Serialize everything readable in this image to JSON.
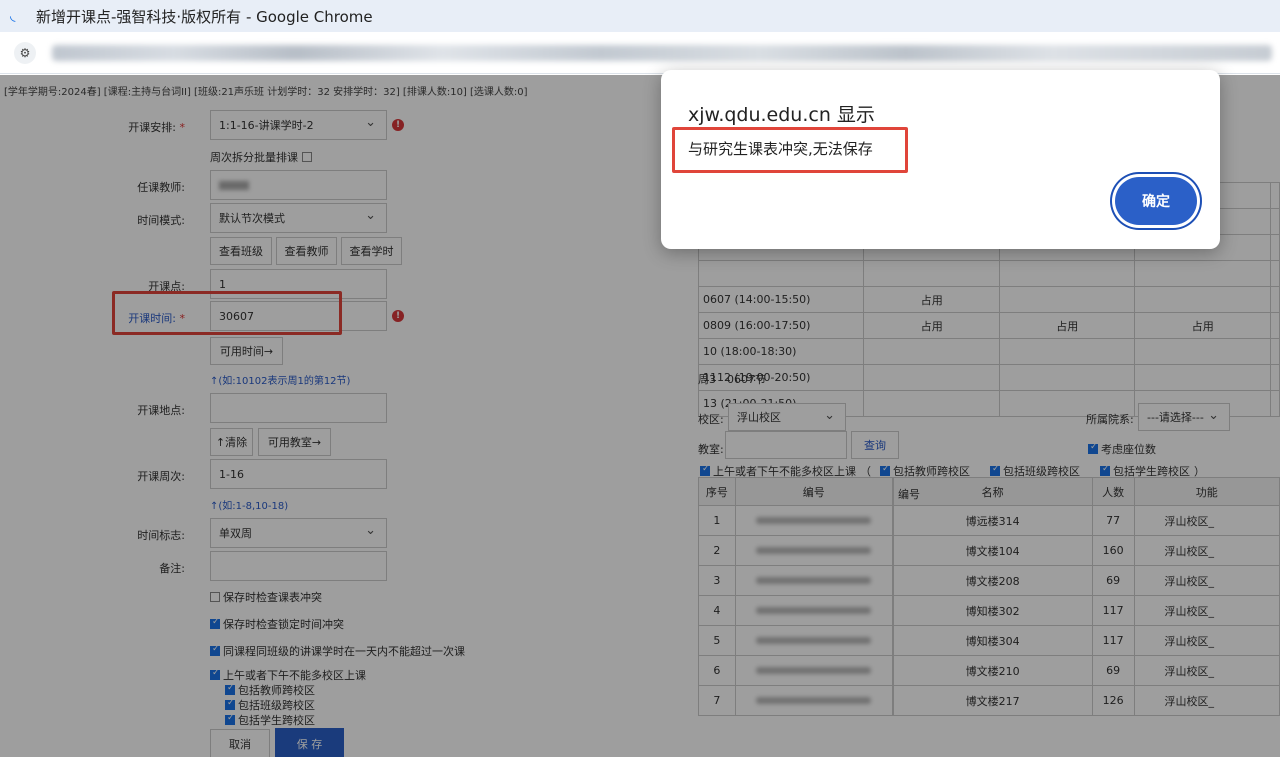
{
  "window": {
    "title": "新增开课点-强智科技·版权所有 - Google Chrome"
  },
  "info_line": "[学年学期号:2024春] [课程:主持与台词II] [班级:21声乐班 计划学时：32 安排学时：32] [排课人数:10] [选课人数:0]",
  "form": {
    "arrangement_label": "开课安排:",
    "arrangement_value": "1:1-16-讲课学时-2",
    "batch_label": "周次拆分批量排课",
    "teacher_label": "任课教师:",
    "teacher_value": "",
    "time_mode_label": "时间模式:",
    "time_mode_value": "默认节次模式",
    "view_class": "查看班级",
    "view_teacher": "查看教师",
    "view_hours": "查看学时",
    "point_label": "开课点:",
    "point_value": "1",
    "time_label": "开课时间:",
    "time_value": "30607",
    "available_time": "可用时间→",
    "time_hint": "↑(如:10102表示周1的第12节)",
    "location_label": "开课地点:",
    "location_value": "",
    "clear": "↑清除",
    "available_room": "可用教室→",
    "weeks_label": "开课周次:",
    "weeks_value": "1-16",
    "weeks_hint": "↑(如:1-8,10-18)",
    "time_flag_label": "时间标志:",
    "time_flag_value": "单双周",
    "remark_label": "备注:",
    "remark_value": "",
    "check1": "保存时检查课表冲突",
    "check2": "保存时检查锁定时间冲突",
    "check3": "同课程同班级的讲课学时在一天内不能超过一次课",
    "check4": "上午或者下午不能多校区上课",
    "check5": "包括教师跨校区",
    "check6": "包括班级跨校区",
    "check7": "包括学生跨校区",
    "cancel": "取消",
    "save": "保 存"
  },
  "timetable": {
    "rows": [
      {
        "slot": "",
        "cells": [
          "",
          "",
          "",
          ""
        ]
      },
      {
        "slot": "",
        "cells": [
          "",
          "",
          "",
          ""
        ]
      },
      {
        "slot": "",
        "cells": [
          "",
          "",
          "",
          ""
        ]
      },
      {
        "slot": "",
        "cells": [
          "",
          "",
          "",
          ""
        ]
      },
      {
        "slot": "0607 (14:00-15:50)",
        "cells": [
          "占用",
          "",
          "",
          ""
        ]
      },
      {
        "slot": "0809 (16:00-17:50)",
        "cells": [
          "占用",
          "占用",
          "占用",
          ""
        ]
      },
      {
        "slot": "10 (18:00-18:30)",
        "cells": [
          "",
          "",
          "",
          ""
        ]
      },
      {
        "slot": "1112 (19:00-20:50)",
        "cells": [
          "",
          "",
          "",
          ""
        ]
      },
      {
        "slot": "13 (21:00-21:50)",
        "cells": [
          "",
          "",
          "",
          ""
        ]
      }
    ],
    "caption": "周3　0607节"
  },
  "room_search": {
    "campus_label": "校区:",
    "campus_value": "浮山校区",
    "dept_label": "所属院系:",
    "dept_value": "---请选择---",
    "classroom_label": "教室:",
    "query": "查询",
    "consider_seats": "考虑座位数",
    "opt1": "上午或者下午不能多校区上课",
    "opt2": "包括教师跨校区",
    "opt3": "包括班级跨校区",
    "opt4": "包括学生跨校区",
    "bracket_open": "（",
    "bracket_close": "）"
  },
  "rooms": {
    "headers": [
      "序号",
      "编号",
      "编号",
      "名称",
      "人数",
      "功能"
    ],
    "rows": [
      {
        "no": "1",
        "name": "博远楼314",
        "count": "77",
        "func": "浮山校区_"
      },
      {
        "no": "2",
        "name": "博文楼104",
        "count": "160",
        "func": "浮山校区_"
      },
      {
        "no": "3",
        "name": "博文楼208",
        "count": "69",
        "func": "浮山校区_"
      },
      {
        "no": "4",
        "name": "博知楼302",
        "count": "117",
        "func": "浮山校区_"
      },
      {
        "no": "5",
        "name": "博知楼304",
        "count": "117",
        "func": "浮山校区_"
      },
      {
        "no": "6",
        "name": "博文楼210",
        "count": "69",
        "func": "浮山校区_"
      },
      {
        "no": "7",
        "name": "博文楼217",
        "count": "126",
        "func": "浮山校区_"
      }
    ]
  },
  "dialog": {
    "title": "xjw.qdu.edu.cn 显示",
    "message": "与研究生课表冲突,无法保存",
    "ok": "确定"
  },
  "colors": {
    "accent": "#2b60c8",
    "highlight_frame": "#e0453a",
    "warning": "#d9373a"
  }
}
